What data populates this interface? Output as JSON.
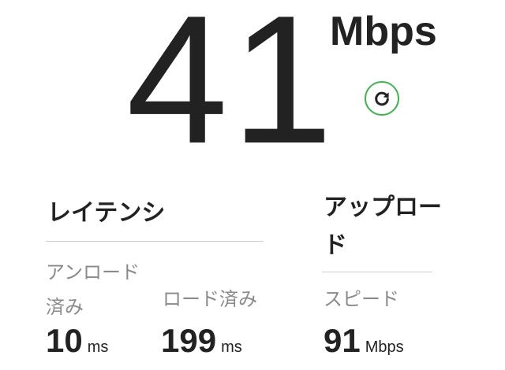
{
  "download": {
    "value": "41",
    "unit": "Mbps",
    "refresh_icon": "refresh-icon",
    "accent_color": "#3cb44b"
  },
  "latency": {
    "title": "レイテンシ",
    "unloaded": {
      "label": "アンロード済み",
      "value": "10",
      "unit": "ms"
    },
    "loaded": {
      "label": "ロード済み",
      "value": "199",
      "unit": "ms"
    }
  },
  "upload": {
    "title": "アップロード",
    "speed": {
      "label": "スピード",
      "value": "91",
      "unit": "Mbps"
    }
  }
}
